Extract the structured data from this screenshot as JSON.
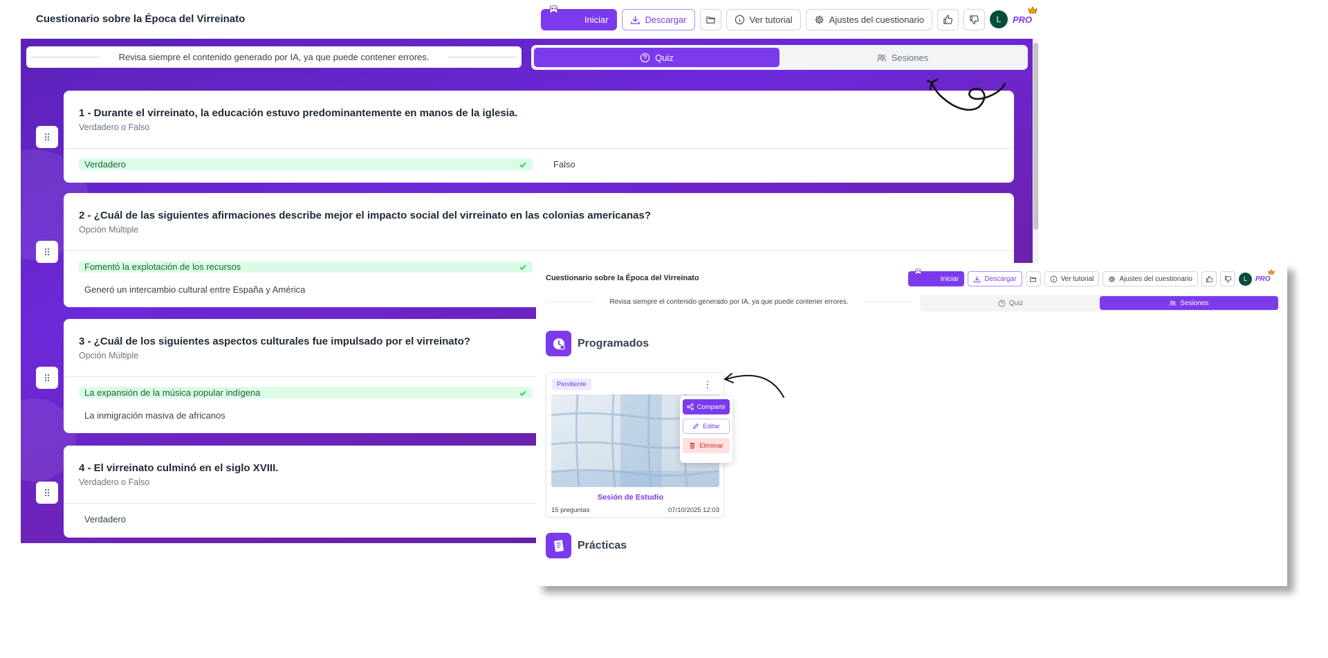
{
  "app": {
    "title": "Cuestionario sobre la Época del Virreinato"
  },
  "toolbar": {
    "start_label": "Iniciar",
    "download_label": "Descargar",
    "tutorial_label": "Ver tutorial",
    "settings_label": "Ajustes del cuestionario",
    "avatar_initial": "L",
    "pro_label": "PRO"
  },
  "notice": {
    "text": "Revisa siempre el contenido generado por IA, ya que puede contener errores."
  },
  "tabs": {
    "quiz_label": "Quiz",
    "sessions_label": "Sesiones"
  },
  "questions": [
    {
      "title": "1 - Durante el virreinato, la educación estuvo predominantemente en manos de la iglesia.",
      "type": "Verdadero o Falso",
      "options": [
        "Verdadero",
        "Falso"
      ],
      "correct": "Verdadero"
    },
    {
      "title": "2 - ¿Cuál de las siguientes afirmaciones describe mejor el impacto social del virreinato en las colonias americanas?",
      "type": "Opción Múltiple",
      "options": [
        "Fomentó la explotación de los recursos",
        "Generó un intercambio cultural entre España y América"
      ],
      "correct": "Fomentó la explotación de los recursos"
    },
    {
      "title": "3 - ¿Cuál de los siguientes aspectos culturales fue impulsado por el virreinato?",
      "type": "Opción Múltiple",
      "options": [
        "La expansión de la música popular indígena",
        "La inmigración masiva de africanos"
      ],
      "correct": "La expansión de la música popular indígena"
    },
    {
      "title": "4 - El virreinato culminó en el siglo XVIII.",
      "type": "Verdadero o Falso",
      "options": [
        "Verdadero"
      ],
      "correct": ""
    }
  ],
  "overlay": {
    "scheduled_label": "Programados",
    "practice_label": "Prácticas",
    "session": {
      "status": "Pendiente",
      "name": "Sesión de Estudio",
      "questions": "15 preguntas",
      "datetime": "07/10/2025 12:03"
    },
    "menu": {
      "share_label": "Compartir",
      "edit_label": "Editar",
      "delete_label": "Eliminar"
    }
  },
  "colors": {
    "accent": "#7c3aed",
    "correct_bg": "#dcfce7",
    "danger": "#dc2626"
  }
}
